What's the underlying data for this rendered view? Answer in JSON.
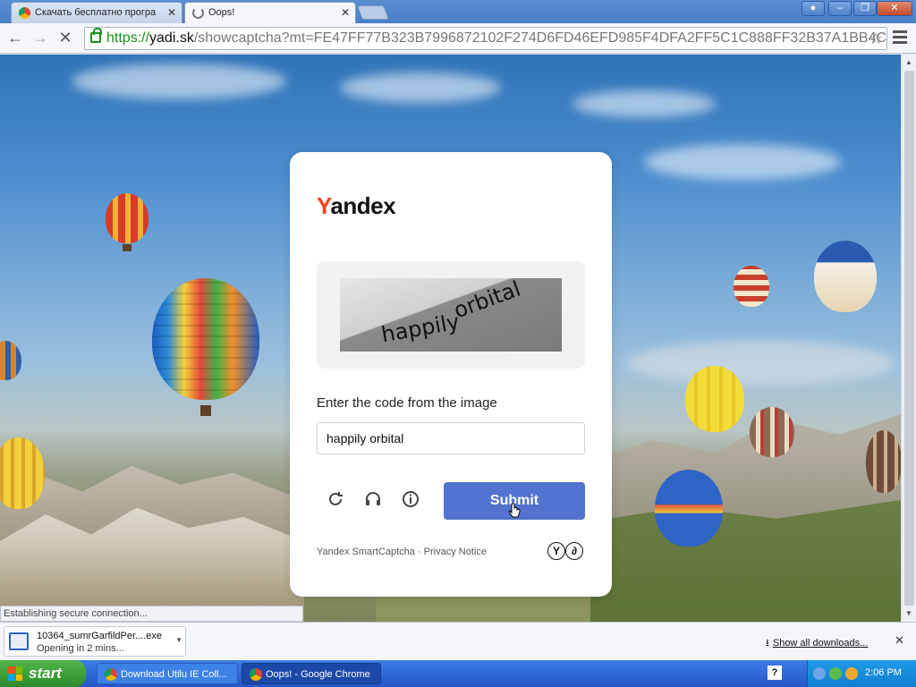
{
  "browser": {
    "tabs": [
      {
        "title": "Скачать бесплатно програ",
        "active": false
      },
      {
        "title": "Oops!",
        "active": true
      }
    ],
    "url": {
      "scheme": "https://",
      "host": "yadi.sk",
      "path": "/showcaptcha?mt=FE47FF77B323B7996872102F274D6FD46EFD985F4DFA2FF5C1C888FF32B37A1BB4C1"
    },
    "status_text": "Establishing secure connection..."
  },
  "captcha": {
    "brand_first_letter": "Y",
    "brand_rest": "andex",
    "image_words": [
      "happily",
      "orbital"
    ],
    "prompt": "Enter the code from the image",
    "input_value": "happily orbital",
    "submit_label": "Submit",
    "footer_brand": "Yandex SmartCaptcha",
    "footer_separator": " · ",
    "footer_privacy": "Privacy Notice",
    "icons": [
      "refresh-icon",
      "audio-icon",
      "info-icon"
    ]
  },
  "downloads": {
    "item": {
      "filename": "10364_sumrGarfildPer....exe",
      "status": "Opening in 2 mins..."
    },
    "show_all": "Show all downloads..."
  },
  "taskbar": {
    "start_label": "start",
    "tasks": [
      {
        "label": "Download Utilu IE Coll..."
      },
      {
        "label": "Oops! - Google Chrome"
      }
    ],
    "clock": "2:06 PM"
  },
  "colors": {
    "yandex_red": "#fc3f1d",
    "submit_blue": "#5274d0",
    "https_green": "#1a8f1a"
  }
}
